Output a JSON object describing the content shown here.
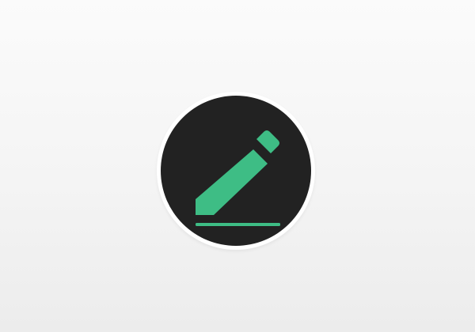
{
  "app": {
    "button": {
      "icon": "pencil-edit-icon",
      "accent_color": "#3ebd85",
      "disc_color": "#222222",
      "ring_color": "#ffffff"
    }
  }
}
